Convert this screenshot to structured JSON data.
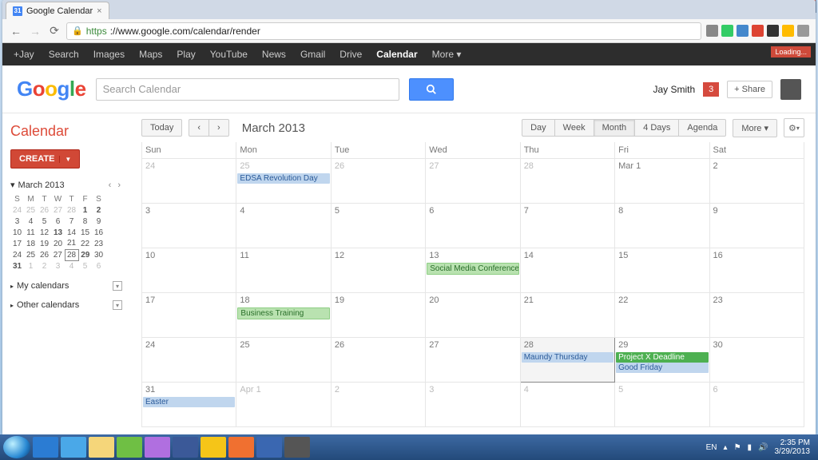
{
  "window": {
    "title": "Google Calendar"
  },
  "browser": {
    "tab_title": "Google Calendar",
    "url_scheme": "https",
    "url_rest": "://www.google.com/calendar/render",
    "loading_label": "Loading..."
  },
  "blackbar": {
    "items": [
      "+Jay",
      "Search",
      "Images",
      "Maps",
      "Play",
      "YouTube",
      "News",
      "Gmail",
      "Drive",
      "Calendar",
      "More"
    ],
    "active_index": 9
  },
  "gbar": {
    "search_placeholder": "Search Calendar",
    "user_name": "Jay Smith",
    "notif_count": "3",
    "share_label": "+  Share"
  },
  "sidebar": {
    "app_title": "Calendar",
    "create_label": "CREATE",
    "mini_month": "March 2013",
    "dow": [
      "S",
      "M",
      "T",
      "W",
      "T",
      "F",
      "S"
    ],
    "weeks": [
      [
        {
          "n": "24",
          "dim": true
        },
        {
          "n": "25",
          "dim": true
        },
        {
          "n": "26",
          "dim": true
        },
        {
          "n": "27",
          "dim": true
        },
        {
          "n": "28",
          "dim": true
        },
        {
          "n": "1",
          "bold": true
        },
        {
          "n": "2",
          "bold": true
        }
      ],
      [
        {
          "n": "3"
        },
        {
          "n": "4"
        },
        {
          "n": "5"
        },
        {
          "n": "6"
        },
        {
          "n": "7"
        },
        {
          "n": "8"
        },
        {
          "n": "9"
        }
      ],
      [
        {
          "n": "10"
        },
        {
          "n": "11"
        },
        {
          "n": "12"
        },
        {
          "n": "13",
          "bold": true
        },
        {
          "n": "14"
        },
        {
          "n": "15"
        },
        {
          "n": "16"
        }
      ],
      [
        {
          "n": "17"
        },
        {
          "n": "18"
        },
        {
          "n": "19"
        },
        {
          "n": "20"
        },
        {
          "n": "21"
        },
        {
          "n": "22"
        },
        {
          "n": "23"
        }
      ],
      [
        {
          "n": "24"
        },
        {
          "n": "25"
        },
        {
          "n": "26"
        },
        {
          "n": "27"
        },
        {
          "n": "28",
          "today": true
        },
        {
          "n": "29",
          "bold": true
        },
        {
          "n": "30"
        }
      ],
      [
        {
          "n": "31",
          "bold": true
        },
        {
          "n": "1",
          "dim": true
        },
        {
          "n": "2",
          "dim": true
        },
        {
          "n": "3",
          "dim": true
        },
        {
          "n": "4",
          "dim": true
        },
        {
          "n": "5",
          "dim": true
        },
        {
          "n": "6",
          "dim": true
        }
      ]
    ],
    "my_calendars_label": "My calendars",
    "other_calendars_label": "Other calendars"
  },
  "toolbar": {
    "today_label": "Today",
    "current_month": "March 2013",
    "views": [
      "Day",
      "Week",
      "Month",
      "4 Days",
      "Agenda"
    ],
    "active_view_index": 2,
    "more_label": "More"
  },
  "calendar": {
    "dow": [
      "Sun",
      "Mon",
      "Tue",
      "Wed",
      "Thu",
      "Fri",
      "Sat"
    ],
    "rows": [
      [
        {
          "label": "24",
          "dim": true
        },
        {
          "label": "25",
          "dim": true,
          "events": [
            {
              "text": "EDSA Revolution Day",
              "style": "blue"
            }
          ]
        },
        {
          "label": "26",
          "dim": true
        },
        {
          "label": "27",
          "dim": true
        },
        {
          "label": "28",
          "dim": true
        },
        {
          "label": "Mar 1"
        },
        {
          "label": "2"
        }
      ],
      [
        {
          "label": "3"
        },
        {
          "label": "4"
        },
        {
          "label": "5"
        },
        {
          "label": "6"
        },
        {
          "label": "7"
        },
        {
          "label": "8"
        },
        {
          "label": "9"
        }
      ],
      [
        {
          "label": "10"
        },
        {
          "label": "11"
        },
        {
          "label": "12"
        },
        {
          "label": "13",
          "events": [
            {
              "text": "Social Media Conference",
              "style": "green"
            }
          ]
        },
        {
          "label": "14"
        },
        {
          "label": "15"
        },
        {
          "label": "16"
        }
      ],
      [
        {
          "label": "17"
        },
        {
          "label": "18",
          "events": [
            {
              "text": "Business Training",
              "style": "green"
            }
          ]
        },
        {
          "label": "19"
        },
        {
          "label": "20"
        },
        {
          "label": "21"
        },
        {
          "label": "22"
        },
        {
          "label": "23"
        }
      ],
      [
        {
          "label": "24"
        },
        {
          "label": "25"
        },
        {
          "label": "26"
        },
        {
          "label": "27"
        },
        {
          "label": "28",
          "today": true,
          "events": [
            {
              "text": "Maundy Thursday",
              "style": "blue"
            }
          ]
        },
        {
          "label": "29",
          "events": [
            {
              "text": "Project X Deadline",
              "style": "brightgreen"
            },
            {
              "text": "Good Friday",
              "style": "blue"
            }
          ]
        },
        {
          "label": "30"
        }
      ],
      [
        {
          "label": "31",
          "events": [
            {
              "text": "Easter",
              "style": "blue"
            }
          ]
        },
        {
          "label": "Apr 1",
          "dim": true
        },
        {
          "label": "2",
          "dim": true
        },
        {
          "label": "3",
          "dim": true
        },
        {
          "label": "4",
          "dim": true
        },
        {
          "label": "5",
          "dim": true
        },
        {
          "label": "6",
          "dim": true
        }
      ]
    ]
  },
  "taskbar": {
    "lang": "EN",
    "time": "2:35 PM",
    "date": "3/29/2013"
  }
}
